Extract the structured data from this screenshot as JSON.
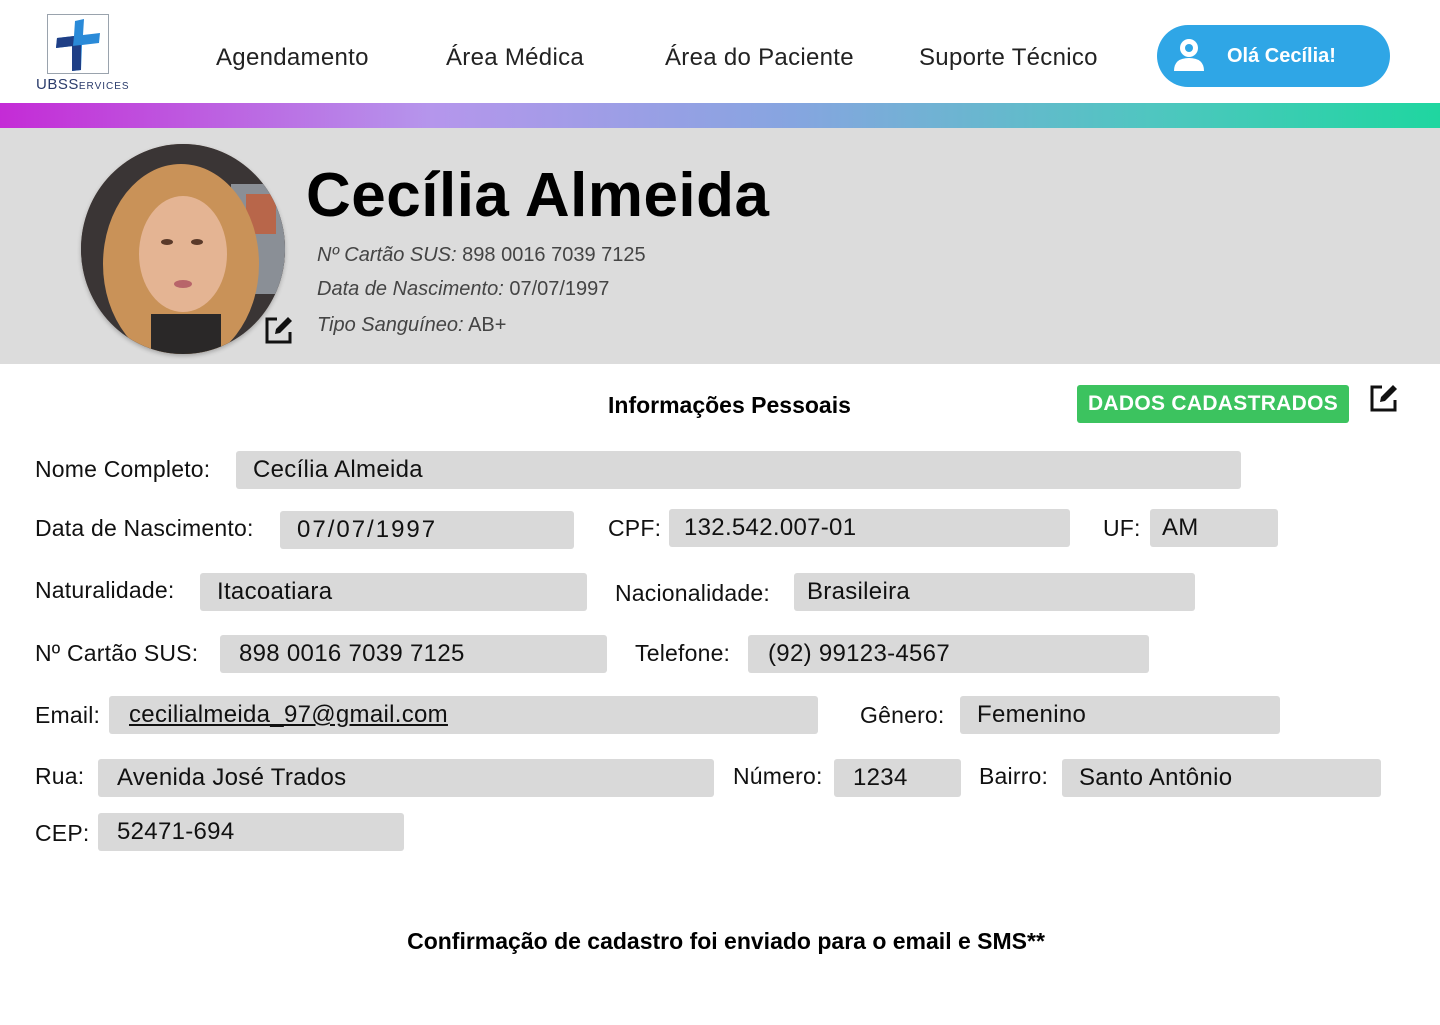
{
  "brand": {
    "logo_text_main": "UBS",
    "logo_text_small": "ERVICES",
    "logo_text_cap": "S"
  },
  "nav": {
    "items": [
      {
        "label": "Agendamento"
      },
      {
        "label": "Área Médica"
      },
      {
        "label": "Área do Paciente"
      },
      {
        "label": "Suporte Técnico"
      }
    ],
    "user_button": "Olá Cecília!"
  },
  "profile": {
    "name": "Cecília Almeida",
    "sus_label": "Nº Cartão SUS:",
    "sus_value": "898 0016 7039 7125",
    "birth_label": "Data de Nascimento:",
    "birth_value": "07/07/1997",
    "blood_label": "Tipo Sanguíneo:",
    "blood_value": "AB+"
  },
  "section": {
    "title": "Informações Pessoais",
    "status_badge": "DADOS CADASTRADOS"
  },
  "form": {
    "full_name": {
      "label": "Nome Completo:",
      "value": "Cecília Almeida"
    },
    "birth_date": {
      "label": "Data de Nascimento:",
      "value": "07/07/1997"
    },
    "cpf": {
      "label": "CPF:",
      "value": "132.542.007-01"
    },
    "uf": {
      "label": "UF:",
      "value": "AM"
    },
    "birthplace": {
      "label": "Naturalidade:",
      "value": "Itacoatiara"
    },
    "nationality": {
      "label": "Nacionalidade:",
      "value": "Brasileira"
    },
    "sus_card": {
      "label": "Nº Cartão SUS:",
      "value": "898 0016 7039 7125"
    },
    "phone": {
      "label": "Telefone:",
      "value": "(92) 99123-4567"
    },
    "email": {
      "label": "Email:",
      "value": "cecilialmeida_97@gmail.com"
    },
    "gender": {
      "label": "Gênero:",
      "value": "Femenino"
    },
    "street": {
      "label": "Rua:",
      "value": "Avenida José Trados"
    },
    "number": {
      "label": "Número:",
      "value": "1234"
    },
    "district": {
      "label": "Bairro:",
      "value": "Santo Antônio"
    },
    "cep": {
      "label": "CEP:",
      "value": "52471-694"
    }
  },
  "footer": {
    "note": "Confirmação de cadastro foi enviado para o email e SMS**"
  },
  "colors": {
    "accent_blue": "#2fa6e6",
    "success_green": "#3cc35f",
    "banner_gray": "#dcdcdc",
    "field_gray": "#d9d9d9",
    "gradient_start": "#c42bd6",
    "gradient_end": "#1fd6a0"
  },
  "icons": {
    "user": "user-icon",
    "edit": "edit-icon",
    "logo": "medical-cross-logo"
  }
}
